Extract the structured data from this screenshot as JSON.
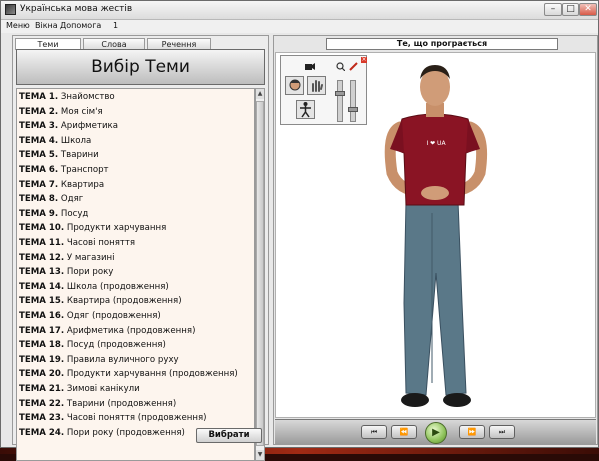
{
  "window": {
    "title": "Українська мова жестів",
    "minimize": "–",
    "maximize": "□",
    "close": "✕"
  },
  "menu": [
    "Меню",
    "Вікна",
    "Допомога",
    "1"
  ],
  "left_panel": {
    "tabs": [
      "Теми",
      "Слова",
      "Речення"
    ],
    "active_tab": 0,
    "header": "Вибір Теми",
    "topics": [
      {
        "label": "ТЕМА 1.",
        "name": "Знайомство"
      },
      {
        "label": "ТЕМА 2.",
        "name": "Моя сім'я"
      },
      {
        "label": "ТЕМА 3.",
        "name": "Арифметика"
      },
      {
        "label": "ТЕМА 4.",
        "name": "Школа"
      },
      {
        "label": "ТЕМА 5.",
        "name": "Тварини"
      },
      {
        "label": "ТЕМА 6.",
        "name": "Транспорт"
      },
      {
        "label": "ТЕМА 7.",
        "name": "Квартира"
      },
      {
        "label": "ТЕМА 8.",
        "name": "Одяг"
      },
      {
        "label": "ТЕМА 9.",
        "name": "Посуд"
      },
      {
        "label": "ТЕМА 10.",
        "name": "Продукти харчування"
      },
      {
        "label": "ТЕМА 11.",
        "name": "Часові поняття"
      },
      {
        "label": "ТЕМА 12.",
        "name": "У магазині"
      },
      {
        "label": "ТЕМА 13.",
        "name": "Пори року"
      },
      {
        "label": "ТЕМА 14.",
        "name": "Школа (продовження)"
      },
      {
        "label": "ТЕМА 15.",
        "name": "Квартира (продовження)"
      },
      {
        "label": "ТЕМА 16.",
        "name": "Одяг (продовження)"
      },
      {
        "label": "ТЕМА 17.",
        "name": "Арифметика (продовження)"
      },
      {
        "label": "ТЕМА 18.",
        "name": "Посуд (продовження)"
      },
      {
        "label": "ТЕМА 19.",
        "name": "Правила вуличного руху"
      },
      {
        "label": "ТЕМА 20.",
        "name": "Продукти харчування (продовження)"
      },
      {
        "label": "ТЕМА 21.",
        "name": "Зимові канікули"
      },
      {
        "label": "ТЕМА 22.",
        "name": "Тварини (продовження)"
      },
      {
        "label": "ТЕМА 23.",
        "name": "Часові поняття (продовження)"
      },
      {
        "label": "ТЕМА 24.",
        "name": "Пори року (продовження)"
      }
    ],
    "select_button": "Вибрати"
  },
  "right_panel": {
    "header": "Те, що програється",
    "avatar_shirt_text": "I ❤ UA"
  },
  "playback": {
    "buttons": [
      "⏮",
      "⏪",
      "▶",
      "⏩",
      "⏭"
    ]
  },
  "colors": {
    "list_bg": "#fdf5ee",
    "play_green": "#8ec25a",
    "shirt": "#8a1424",
    "jeans": "#5a7888"
  }
}
